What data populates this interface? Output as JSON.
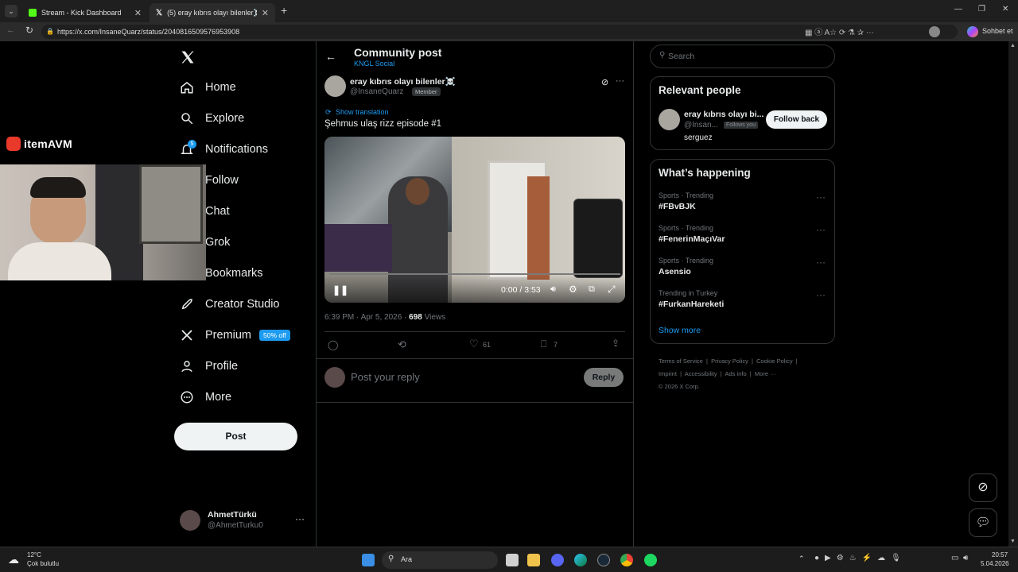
{
  "browser": {
    "tabs": [
      {
        "title": "Stream - Kick Dashboard"
      },
      {
        "title": "(5) eray kıbrıs olayı bilenler☠️ on X"
      }
    ],
    "url": "https://x.com/InsaneQuarz/status/2040816509576953908",
    "copilot_label": "Sohbet et"
  },
  "overlay": {
    "brand": "itemAVM"
  },
  "sidebar": {
    "items": [
      {
        "label": "Home",
        "icon": "home-icon"
      },
      {
        "label": "Explore",
        "icon": "search-icon"
      },
      {
        "label": "Notifications",
        "icon": "bell-icon",
        "badge": "5"
      },
      {
        "label": "Follow",
        "icon": "follow-icon"
      },
      {
        "label": "Chat",
        "icon": "chat-icon"
      },
      {
        "label": "Grok",
        "icon": "grok-icon"
      },
      {
        "label": "Bookmarks",
        "icon": "bookmark-icon"
      },
      {
        "label": "Creator Studio",
        "icon": "rocket-icon"
      },
      {
        "label": "Premium",
        "icon": "x-icon",
        "badge": "50% off"
      },
      {
        "label": "Profile",
        "icon": "person-icon"
      },
      {
        "label": "More",
        "icon": "more-circle-icon"
      }
    ],
    "post_button": "Post",
    "account": {
      "name": "AhmetTürkü",
      "handle": "@AhmetTurku0"
    }
  },
  "main": {
    "header_title": "Community post",
    "header_sub": "KNGL Social",
    "author_name": "eray kıbrıs olayı bilenler☠️",
    "author_handle": "@InsaneQuarz",
    "member_badge": "Member",
    "show_translation": "Show translation",
    "post_text": "Şehmus ulaş rizz episode #1",
    "video_time": "0:00 / 3:53",
    "timestamp": "6:39 PM · Apr 5, 2026 · ",
    "views_count": "698",
    "views_label": " Views",
    "likes": "61",
    "bookmarks": "7",
    "reply_placeholder": "Post your reply",
    "reply_button": "Reply"
  },
  "right": {
    "search_placeholder": "Search",
    "relevant_title": "Relevant people",
    "person_name": "eray kıbrıs olayı bi...",
    "person_handle": "@Insan...",
    "follows_you": "Follows you",
    "follow_back": "Follow back",
    "person_bio": "serguez",
    "happening_title": "What’s happening",
    "trends": [
      {
        "meta": "Sports · Trending",
        "tag": "#FBvBJK"
      },
      {
        "meta": "Sports · Trending",
        "tag": "#FenerinMaçıVar"
      },
      {
        "meta": "Sports · Trending",
        "tag": "Asensio"
      },
      {
        "meta": "Trending in Turkey",
        "tag": "#FurkanHareketi"
      }
    ],
    "show_more": "Show more",
    "footer_row1": [
      "Terms of Service",
      "Privacy Policy",
      "Cookie Policy"
    ],
    "footer_row2": [
      "Imprint",
      "Accessibility",
      "Ads info",
      "More ···"
    ],
    "copyright": "© 2026 X Corp."
  },
  "taskbar": {
    "weather_temp": "12°C",
    "weather_desc": "Çok bulutlu",
    "search_label": "Ara",
    "time": "20:57",
    "date": "5.04.2026"
  },
  "colors": {
    "accent": "#1d9bf0",
    "background": "#000000",
    "border": "#2f3336",
    "premium_badge": "#1d9bf0"
  }
}
